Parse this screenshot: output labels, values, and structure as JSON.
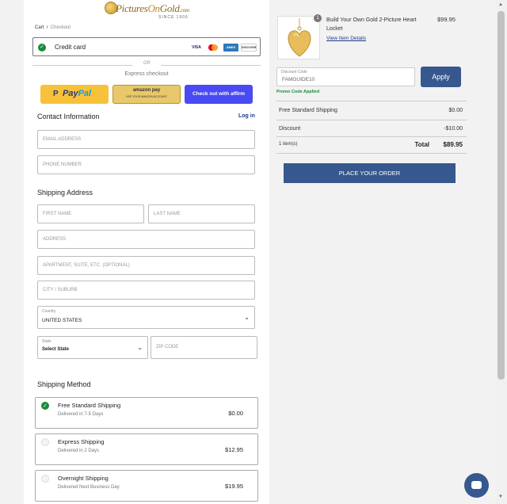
{
  "brand": {
    "logo_text_1": "Pictures",
    "logo_text_2": "On",
    "logo_text_3": "Gold",
    "logo_suffix": ".com",
    "since": "SINCE 1906"
  },
  "breadcrumb": {
    "cart": "Cart",
    "checkout": "Checkout"
  },
  "payment": {
    "credit_card_label": "Credit card",
    "card_logos": [
      "VISA",
      "MC",
      "AMEX",
      "DISCOVER"
    ],
    "or_label": "OR",
    "express_label": "Express checkout",
    "paypal_label_1": "Pay",
    "paypal_label_2": "Pal",
    "amazon_label": "amazon pay",
    "amazon_sub": "USE YOUR AMAZON ACCOUNT",
    "affirm_label": "Check out with affirm"
  },
  "contact": {
    "heading": "Contact Information",
    "login_link": "Log in",
    "email_placeholder": "EMAIL ADDRESS",
    "phone_placeholder": "PHONE NUMBER"
  },
  "shipping_address": {
    "heading": "Shipping Address",
    "first_name_placeholder": "FIRST NAME",
    "last_name_placeholder": "LAST NAME",
    "address_placeholder": "ADDRESS",
    "apartment_placeholder": "APARTMENT, SUITE, ETC. (OPTIONAL)",
    "city_placeholder": "CITY / SUBURB",
    "country_label": "Country",
    "country_value": "UNITED STATES",
    "state_label": "State",
    "state_value": "Select State",
    "zip_placeholder": "ZIP CODE"
  },
  "shipping_method": {
    "heading": "Shipping Method",
    "options": [
      {
        "name": "Free Standard Shipping",
        "sub": "Delivered in 7-5 Days",
        "price": "$0.00",
        "selected": true
      },
      {
        "name": "Express Shipping",
        "sub": "Delivered in 2 Days",
        "price": "$12.95",
        "selected": false
      },
      {
        "name": "Overnight Shipping",
        "sub": "Delivered Next Business Day",
        "price": "$19.95",
        "selected": false
      }
    ]
  },
  "order": {
    "item_count_badge": "1",
    "item_title": "Build Your Own Gold 2-Picture Heart Locket",
    "item_link": "View Item Details",
    "item_price": "$99.95",
    "discount_label": "Discount Code",
    "discount_value": "FAMGUIDE10",
    "apply_label": "Apply",
    "promo_applied": "Promo Code Applied",
    "shipping_row_label": "Free Standard Shipping",
    "shipping_row_value": "$0.00",
    "discount_row_label": "Discount",
    "discount_row_value": "-$10.00",
    "items_label": "1 item(s)",
    "total_label": "Total",
    "total_value": "$89.95",
    "place_order_label": "PLACE YOUR ORDER"
  },
  "colors": {
    "primary": "#36588e",
    "success": "#1a8a3c",
    "paypal": "#f7c23a",
    "affirm": "#4a4af4"
  }
}
